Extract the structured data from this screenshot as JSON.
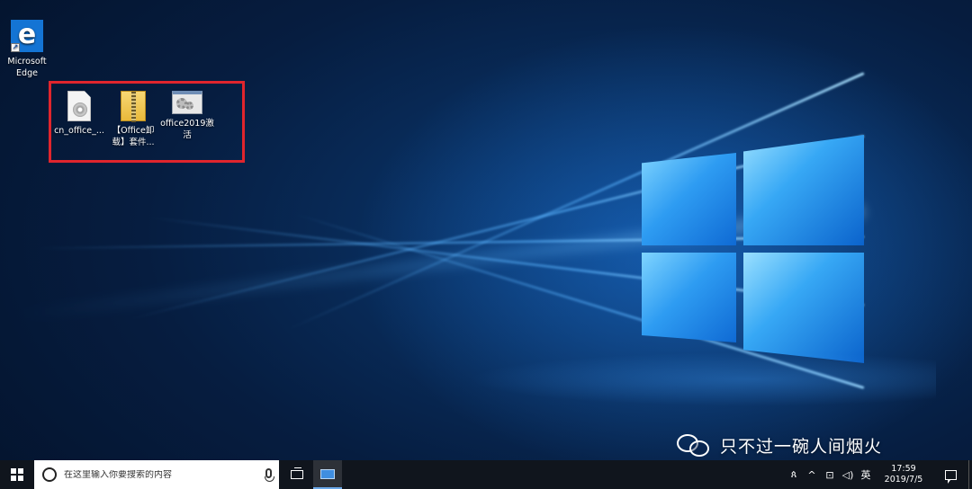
{
  "desktop": {
    "icons": [
      {
        "label": "Microsoft Edge",
        "icon": "edge-browser-icon",
        "glyph": "e"
      },
      {
        "label": "cn_office_...",
        "icon": "iso-disc-file-icon"
      },
      {
        "label": "【Office卸载】套件...",
        "icon": "zip-archive-icon"
      },
      {
        "label": "office2019激活",
        "icon": "settings-file-icon"
      }
    ],
    "selection_color": "#e0252d"
  },
  "watermark": {
    "text": "只不过一碗人间烟火"
  },
  "taskbar": {
    "search_placeholder": "在这里输入你要搜索的内容",
    "tray": {
      "people": "ጰ",
      "chevron": "^",
      "network": "⊡",
      "volume": "◁)",
      "ime": "英"
    },
    "clock": {
      "time": "17:59",
      "date": "2019/7/5"
    }
  },
  "colors": {
    "taskbar": "#10151d",
    "accent": "#1474d4"
  }
}
